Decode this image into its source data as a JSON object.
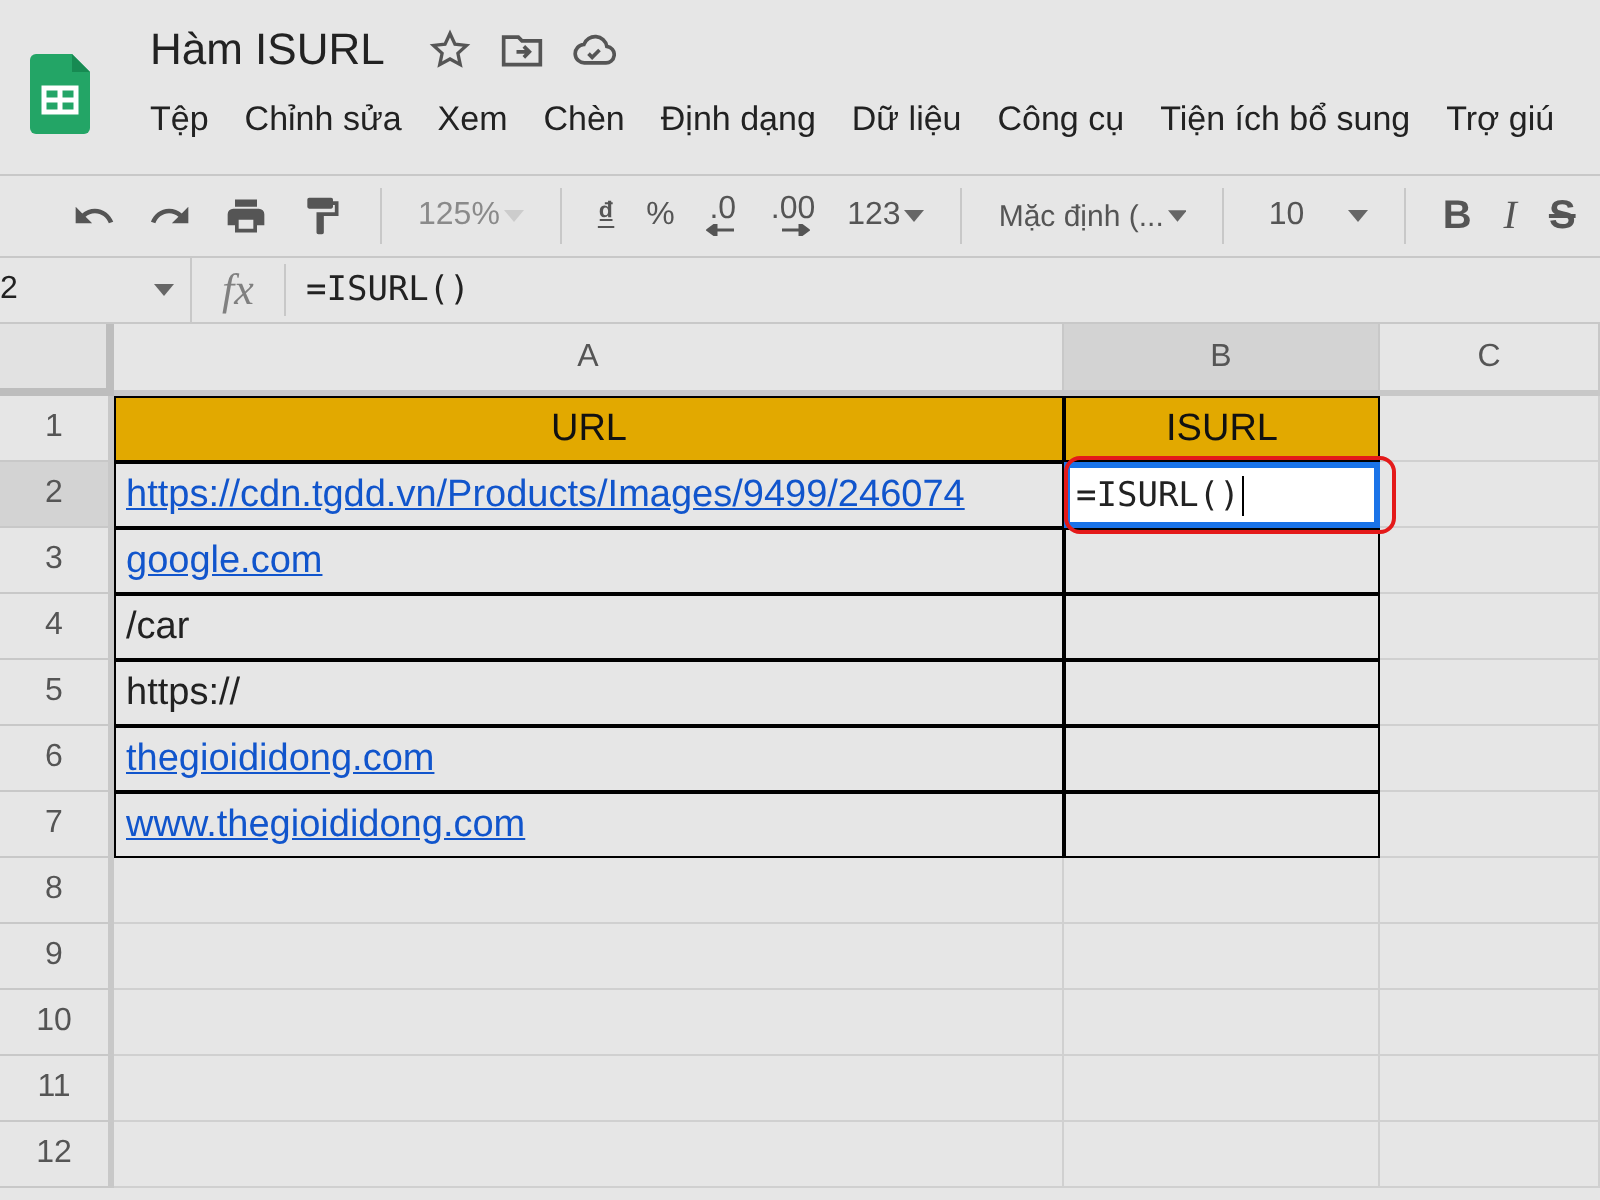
{
  "document": {
    "title": "Hàm ISURL"
  },
  "menu": [
    "Tệp",
    "Chỉnh sửa",
    "Xem",
    "Chèn",
    "Định dạng",
    "Dữ liệu",
    "Công cụ",
    "Tiện ích bổ sung",
    "Trợ giú"
  ],
  "toolbar": {
    "zoom": {
      "value": "125%",
      "disabled": true
    },
    "currency": "₫",
    "percent": "%",
    "decrease_decimals": ".0",
    "increase_decimals": ".00",
    "number_format": "123",
    "font": "Mặc định (...",
    "font_size": "10",
    "style_buttons": [
      "B",
      "I",
      "S"
    ]
  },
  "formula_bar": {
    "name_box": "2",
    "fx": "fx",
    "formula": "=ISURL()"
  },
  "grid": {
    "columns": [
      {
        "label": "A",
        "selected": false
      },
      {
        "label": "B",
        "selected": true
      },
      {
        "label": "C",
        "selected": false
      }
    ],
    "rows": [
      {
        "number": "1",
        "selected": false,
        "cells": [
          {
            "kind": "header",
            "text": "URL"
          },
          {
            "kind": "header",
            "text": "ISURL"
          },
          {
            "kind": "empty"
          }
        ]
      },
      {
        "number": "2",
        "selected": true,
        "cells": [
          {
            "kind": "link",
            "text": "https://cdn.tgdd.vn/Products/Images/9499/246074"
          },
          {
            "kind": "editing",
            "text": "=ISURL()",
            "highlighted": true
          },
          {
            "kind": "empty"
          }
        ]
      },
      {
        "number": "3",
        "selected": false,
        "cells": [
          {
            "kind": "link",
            "text": "google.com"
          },
          {
            "kind": "blank"
          },
          {
            "kind": "empty"
          }
        ]
      },
      {
        "number": "4",
        "selected": false,
        "cells": [
          {
            "kind": "text",
            "text": "/car"
          },
          {
            "kind": "blank"
          },
          {
            "kind": "empty"
          }
        ]
      },
      {
        "number": "5",
        "selected": false,
        "cells": [
          {
            "kind": "text",
            "text": "https://"
          },
          {
            "kind": "blank"
          },
          {
            "kind": "empty"
          }
        ]
      },
      {
        "number": "6",
        "selected": false,
        "cells": [
          {
            "kind": "link",
            "text": "thegioididong.com"
          },
          {
            "kind": "blank"
          },
          {
            "kind": "empty"
          }
        ]
      },
      {
        "number": "7",
        "selected": false,
        "cells": [
          {
            "kind": "link",
            "text": "www.thegioididong.com"
          },
          {
            "kind": "blank"
          },
          {
            "kind": "empty"
          }
        ]
      },
      {
        "number": "8",
        "selected": false,
        "cells": [
          {
            "kind": "empty"
          },
          {
            "kind": "empty"
          },
          {
            "kind": "empty"
          }
        ]
      },
      {
        "number": "9",
        "selected": false,
        "cells": [
          {
            "kind": "empty"
          },
          {
            "kind": "empty"
          },
          {
            "kind": "empty"
          }
        ]
      },
      {
        "number": "10",
        "selected": false,
        "cells": [
          {
            "kind": "empty"
          },
          {
            "kind": "empty"
          },
          {
            "kind": "empty"
          }
        ]
      },
      {
        "number": "11",
        "selected": false,
        "cells": [
          {
            "kind": "empty"
          },
          {
            "kind": "empty"
          },
          {
            "kind": "empty"
          }
        ]
      },
      {
        "number": "12",
        "selected": false,
        "cells": [
          {
            "kind": "empty"
          },
          {
            "kind": "empty"
          },
          {
            "kind": "empty"
          }
        ]
      }
    ]
  }
}
